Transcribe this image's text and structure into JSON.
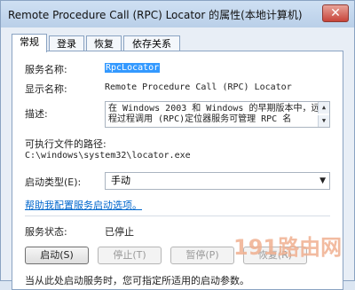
{
  "window": {
    "title": "Remote Procedure Call (RPC) Locator 的属性(本地计算机)",
    "close_symbol": "✕"
  },
  "tabs": [
    {
      "label": "常规"
    },
    {
      "label": "登录"
    },
    {
      "label": "恢复"
    },
    {
      "label": "依存关系"
    }
  ],
  "general": {
    "service_name_label": "服务名称:",
    "service_name": "RpcLocator",
    "display_name_label": "显示名称:",
    "display_name": "Remote Procedure Call (RPC) Locator",
    "description_label": "描述:",
    "description": "在 Windows 2003 和 Windows 的早期版本中，远程过程调用 (RPC)定位器服务可管理 RPC 名",
    "exe_path_label": "可执行文件的路径:",
    "exe_path": "C:\\windows\\system32\\locator.exe",
    "startup_type_label": "启动类型(E):",
    "startup_type_value": "手动",
    "help_link": "帮助我配置服务启动选项。",
    "status_label": "服务状态:",
    "status_value": "已停止",
    "buttons": {
      "start": "启动(S)",
      "stop": "停止(T)",
      "pause": "暂停(P)",
      "resume": "恢复(R)"
    },
    "footer_note": "当从此处启动服务时，您可指定所适用的启动参数。"
  },
  "watermark": "191路由网"
}
